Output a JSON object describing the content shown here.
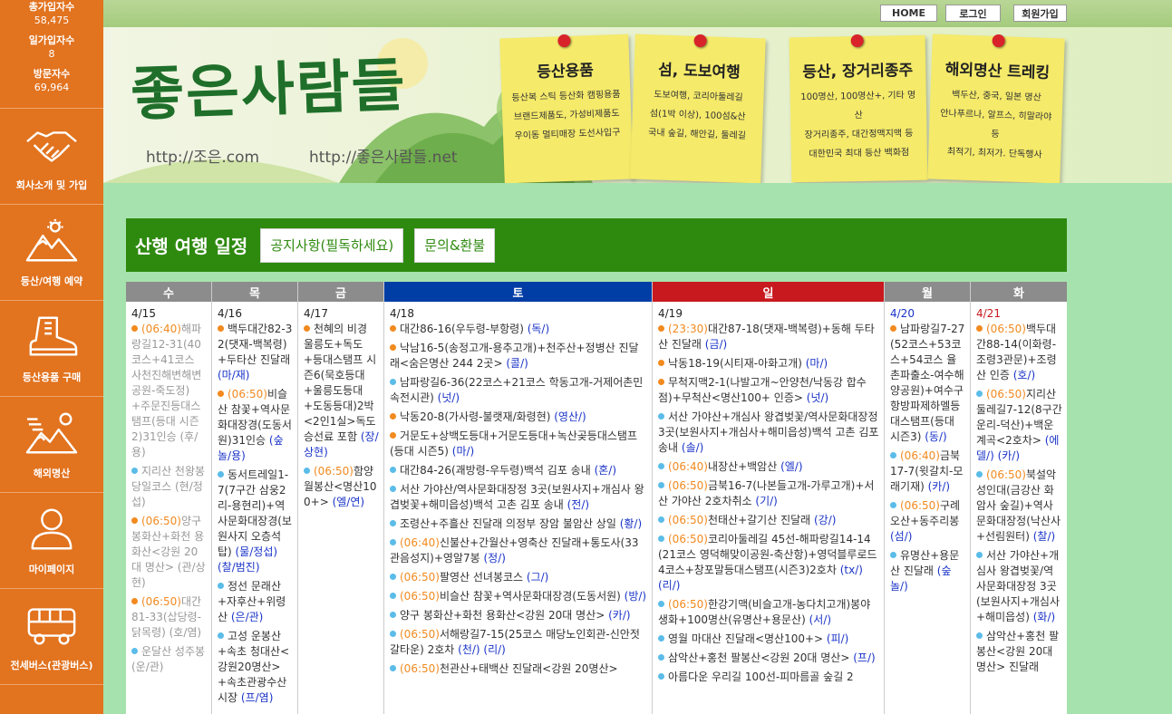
{
  "stats": [
    {
      "label": "총가입자수",
      "value": "58,475"
    },
    {
      "label": "일가입자수",
      "value": "8"
    },
    {
      "label": "방문자수",
      "value": "69,964"
    }
  ],
  "nav": [
    {
      "label": "회사소개 및 가입",
      "icon": "handshake-icon"
    },
    {
      "label": "등산/여행 예약",
      "icon": "mountain-sun-icon"
    },
    {
      "label": "등산용품 구매",
      "icon": "hiking-boot-icon"
    },
    {
      "label": "해외명산",
      "icon": "mountain-range-icon"
    },
    {
      "label": "마이페이지",
      "icon": "user-icon"
    },
    {
      "label": "전세버스(관광버스)",
      "icon": "bus-icon"
    }
  ],
  "topbar": {
    "home": "HOME",
    "login": "로그인",
    "join": "회원가입"
  },
  "banner": {
    "logo": "좋은사람들",
    "url1": "http://조은.com",
    "url2": "http://좋은사람들.net",
    "notes": [
      {
        "title": "등산용품",
        "lines": [
          "등산복 스틱 등산화 캠핑용품",
          "브랜드제품도, 가성비제품도",
          "우이동 멀티매장 도선사입구"
        ]
      },
      {
        "title": "섬, 도보여행",
        "lines": [
          "도보여행, 코리아둘레길",
          "섬(1박 이상), 100섬&산",
          "국내 숲길, 해안길, 둘레길"
        ]
      },
      {
        "title": "등산, 장거리종주",
        "lines": [
          "100명산, 100명산+, 기타 명산",
          "장거리종주, 대간정맥지맥 등",
          "대한민국 최대 등산 백화점"
        ]
      },
      {
        "title": "해외명산 트레킹",
        "lines": [
          "백두산, 중국, 일본 명산",
          "안나푸르나, 알프스, 히말라야 등",
          "최적기, 최저가. 단독행사"
        ]
      }
    ]
  },
  "schedule": {
    "title": "산행 여행 일정",
    "notice_btn": "공지사항(필독하세요)",
    "inquiry_btn": "문의&환불"
  },
  "colors": {
    "orange": "#e2731f",
    "green": "#2e8a0f",
    "sat": "#003da5",
    "sun": "#c8191e",
    "gray": "#8c8c8c"
  },
  "days": [
    {
      "name": "수",
      "date": "4/15",
      "events": [
        {
          "dot": "o",
          "time": "(06:40)",
          "text": "해파랑길12-31(40코스+41코스 사천진해변해변공원-죽도정)+주문진등대스탬프(등대 시즌2)31인승 (후/용)",
          "past": true
        },
        {
          "dot": "b",
          "time": "",
          "text": "지리산 천왕봉 당일코스 (현/정섭)",
          "past": true
        },
        {
          "dot": "o",
          "time": "(06:50)",
          "text": "양구 봉화산+화천 용화산<강원 20대 명산> (관/상현)",
          "past": true
        },
        {
          "dot": "o",
          "time": "(06:50)",
          "text": "대간81-33(삽당령-닭목령) (호/염)",
          "past": true
        },
        {
          "dot": "b",
          "time": "",
          "text": "운달산 성주봉 (운/관)",
          "past": true
        }
      ]
    },
    {
      "name": "목",
      "date": "4/16",
      "events": [
        {
          "dot": "o",
          "time": "",
          "text": "백두대간82-32(댓재-백복령)+두타산 진달래 ",
          "lead": "(마/재)"
        },
        {
          "dot": "o",
          "time": "(06:50)",
          "text": "비슬산 참꽃+역사문화대장경(도동서원)31인승 ",
          "lead": "(숲놀/용)"
        },
        {
          "dot": "b",
          "time": "",
          "text": "동서트레일1-7(7구간 삼웅2리-용현리)+역사문화대장경(보원사지 오층석탑) ",
          "lead": "(물/정섭) (찰/범진)"
        },
        {
          "dot": "b",
          "time": "",
          "text": "정선 문래산+자후산+위령산 ",
          "lead": "(은/관)"
        },
        {
          "dot": "b",
          "time": "",
          "text": "고성 운봉산+속초 청대산<강원20명산>+속초관광수산시장 ",
          "lead": "(프/염)"
        }
      ]
    },
    {
      "name": "금",
      "date": "4/17",
      "events": [
        {
          "dot": "o",
          "time": "",
          "text": "천혜의 비경 울릉도+독도+등대스탬프 시즌6(묵호등대+울릉도등대+도동등대)2박<2인1실>독도승선료 포함 ",
          "lead": "(장/상현)"
        },
        {
          "dot": "b",
          "time": "(06:50)",
          "text": "함양 월봉산<명산100+> ",
          "lead": "(엘/연)"
        }
      ]
    },
    {
      "name": "토",
      "date": "4/18",
      "events": [
        {
          "dot": "o",
          "time": "",
          "text": "대간86-16(우두령-부항령) ",
          "lead": "(독/)"
        },
        {
          "dot": "o",
          "time": "",
          "text": "낙남16-5(송정고개-용추고개)+천주산+정병산 진달래<숨은명산 244 2곳> ",
          "lead": "(콜/)"
        },
        {
          "dot": "b",
          "time": "",
          "text": "남파랑길6-36(22코스+21코스 학동고개-거제어촌민속전시관) ",
          "lead": "(넛/)"
        },
        {
          "dot": "o",
          "time": "",
          "text": "낙동20-8(가사령-불랫재/화령현) ",
          "lead": "(영산/)"
        },
        {
          "dot": "o",
          "time": "",
          "text": "거문도+상백도등대+거문도등대+녹산곶등대스탬프(등대 시즌5) ",
          "lead": "(마/)"
        },
        {
          "dot": "b",
          "time": "",
          "text": "대간84-26(괘방령-우두령)백석 김포 송내 ",
          "lead": "(혼/)"
        },
        {
          "dot": "b",
          "time": "",
          "text": "서산 가야산/역사문화대장정 3곳(보원사지+개심사 왕겹벚꽃+해미읍성)백석 고촌 김포 송내 ",
          "lead": "(전/)"
        },
        {
          "dot": "b",
          "time": "",
          "text": "조령산+주흘산 진달래 의정부 장암 불암산 상일 ",
          "lead": "(황/)"
        },
        {
          "dot": "b",
          "time": "(06:40)",
          "text": "신불산+간월산+영축산 진달래+통도사(33관음성지)+영알7봉 ",
          "lead": "(정/)"
        },
        {
          "dot": "b",
          "time": "(06:50)",
          "text": "팔영산 선녀봉코스 ",
          "lead": "(그/)"
        },
        {
          "dot": "b",
          "time": "(06:50)",
          "text": "비슬산 참꽃+역사문화대장경(도동서원) ",
          "lead": "(방/)"
        },
        {
          "dot": "b",
          "time": "",
          "text": "양구 봉화산+화천 용화산<강원 20대 명산> ",
          "lead": "(카/)"
        },
        {
          "dot": "b",
          "time": "(06:50)",
          "text": "서해랑길7-15(25코스 매당노인회관-신안젓갈타운) 2호차 ",
          "lead": "(천/) (리/)"
        },
        {
          "dot": "b",
          "time": "(06:50)",
          "text": "천관산+태백산 진달래<강원 20명산>",
          "lead": ""
        }
      ]
    },
    {
      "name": "일",
      "date": "4/19",
      "events": [
        {
          "dot": "o",
          "time": "(23:30)",
          "text": "대간87-18(댓재-백복령)+동해 두타산 진달래 ",
          "lead": "(금/)"
        },
        {
          "dot": "o",
          "time": "",
          "text": "낙동18-19(시티재-아화고개) ",
          "lead": "(마/)"
        },
        {
          "dot": "o",
          "time": "",
          "text": "무척지맥2-1(나발고개~안양천/낙동강 합수점)+무척산<명산100+ 인증> ",
          "lead": "(넛/)"
        },
        {
          "dot": "b",
          "time": "",
          "text": "서산 가야산+개심사 왕겹벚꽃/역사문화대장정 3곳(보원사지+개심사+해미읍성)백석 고촌 김포 송내 ",
          "lead": "(솔/)"
        },
        {
          "dot": "b",
          "time": "(06:40)",
          "text": "내장산+백암산 ",
          "lead": "(엘/)"
        },
        {
          "dot": "b",
          "time": "(06:50)",
          "text": "금북16-7(나본들고개-가루고개)+서산 가야산 2호차취소 ",
          "lead": "(기/)"
        },
        {
          "dot": "b",
          "time": "(06:50)",
          "text": "천태산+갈기산 진달래 ",
          "lead": "(강/)"
        },
        {
          "dot": "b",
          "time": "(06:50)",
          "text": "코리아둘레길 45선-해파랑길14-14(21코스 영덕해맞이공원-축산항)+영덕블루로드 4코스+창포말등대스탬프(시즌3)2호차 ",
          "lead": "(tx/) (리/)"
        },
        {
          "dot": "b",
          "time": "(06:50)",
          "text": "한강기맥(비슬고개-농다치고개)봉야생화+100명산(유명산+용문산) ",
          "lead": "(서/)"
        },
        {
          "dot": "b",
          "time": "",
          "text": "영월 마대산 진달래<명산100+> ",
          "lead": "(피/)"
        },
        {
          "dot": "b",
          "time": "",
          "text": "삼악산+홍천 팔봉산<강원 20대 명산> ",
          "lead": "(프/)"
        },
        {
          "dot": "b",
          "time": "",
          "text": "아름다운 우리길 100선-피마름골 숲길 2",
          "lead": ""
        }
      ]
    },
    {
      "name": "월",
      "date": "4/20",
      "events": [
        {
          "dot": "o",
          "time": "",
          "text": "남파랑길7-27(52코스+53코스+54코스 율촌파출소-여수해양공원)+여수구항방파제하멜등대스탬프(등대 시즌3) ",
          "lead": "(동/)"
        },
        {
          "dot": "b",
          "time": "(06:40)",
          "text": "금북17-7(윗갈치-모래기재) ",
          "lead": "(카/)"
        },
        {
          "dot": "b",
          "time": "(06:50)",
          "text": "구례 오산+동주리봉 ",
          "lead": "(섬/)"
        },
        {
          "dot": "b",
          "time": "",
          "text": "유명산+용문산 진달래 ",
          "lead": "(숲놀/)"
        }
      ]
    },
    {
      "name": "화",
      "date": "4/21",
      "events": [
        {
          "dot": "o",
          "time": "(06:50)",
          "text": "백두대간88-14(이화령-조령3관문)+조령산 인증 ",
          "lead": "(호/)"
        },
        {
          "dot": "b",
          "time": "(06:50)",
          "text": "지리산둘레길7-12(8구간 운리-덕산)+백운계곡<2호차> ",
          "lead": "(에델/) (카/)"
        },
        {
          "dot": "b",
          "time": "(06:50)",
          "text": "북설악 성인대(금강산 화암사 숲길)+역사문화대장정(낙산사+선림원터) ",
          "lead": "(찰/)"
        },
        {
          "dot": "b",
          "time": "",
          "text": "서산 가야산+개심사 왕겹벚꽃/역사문화대장정 3곳(보원사지+개심사+해미읍성) ",
          "lead": "(화/)"
        },
        {
          "dot": "b",
          "time": "",
          "text": "삼악산+홍천 팔봉산<강원 20대 명산> 진달래",
          "lead": ""
        }
      ]
    }
  ]
}
